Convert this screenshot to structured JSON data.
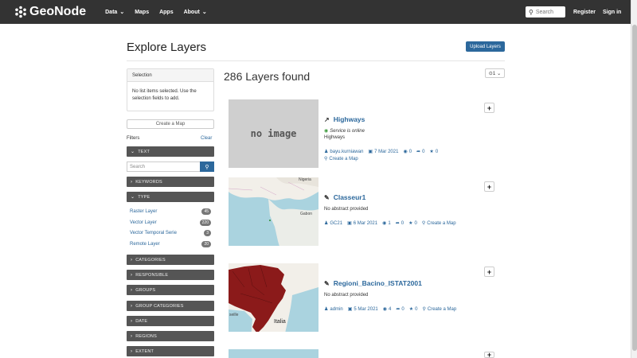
{
  "nav": {
    "brand": "GeoNode",
    "items": [
      "Data",
      "Maps",
      "Apps",
      "About"
    ],
    "search_placeholder": "Search",
    "register": "Register",
    "sign_in": "Sign in"
  },
  "header": {
    "title": "Explore Layers",
    "upload_label": "Upload Layers"
  },
  "sidebar": {
    "selection_title": "Selection",
    "selection_body": "No list items selected. Use the selection fields to add.",
    "create_map": "Create a Map",
    "filters_label": "Filters",
    "clear_label": "Clear",
    "text_facet": "TEXT",
    "search_placeholder": "Search",
    "keywords": "KEYWORDS",
    "type": "TYPE",
    "types": [
      {
        "label": "Raster Layer",
        "count": "45"
      },
      {
        "label": "Vector Layer",
        "count": "220"
      },
      {
        "label": "Vector Temporal Serie",
        "count": "3"
      },
      {
        "label": "Remote Layer",
        "count": "20"
      }
    ],
    "categories": "CATEGORIES",
    "responsible": "RESPONSIBLE",
    "group": "GROUPS",
    "group_categories": "GROUP CATEGORIES",
    "date": "DATE",
    "regions": "REGIONS",
    "extent": "EXTENT"
  },
  "results": {
    "count_label": "286 Layers found",
    "sort_label": "⊙1",
    "items": [
      {
        "title": "Highways",
        "status": "Service is online",
        "abstract": "Highways",
        "owner": "bayu.kurniawan",
        "date": "7 Mar 2021",
        "views": "0",
        "shares": "0",
        "rating": "0",
        "create_map": "Create a Map",
        "thumb_text": "no image"
      },
      {
        "title": "Classeur1",
        "abstract": "No abstract provided",
        "owner": "GC21",
        "date": "6 Mar 2021",
        "views": "1",
        "shares": "0",
        "rating": "0",
        "create_map": "Create a Map",
        "map_labels": [
          "Nigeria",
          "Gabon"
        ]
      },
      {
        "title": "Regioni_Bacino_ISTAT2001",
        "abstract": "No abstract provided",
        "owner": "admin",
        "date": "5 Mar 2021",
        "views": "4",
        "shares": "0",
        "rating": "0",
        "create_map": "Create a Map",
        "map_labels": [
          "Italia",
          "seille"
        ]
      }
    ]
  },
  "colors": {
    "navbar": "#333333",
    "accent": "#2c689c",
    "facet": "#555555"
  }
}
